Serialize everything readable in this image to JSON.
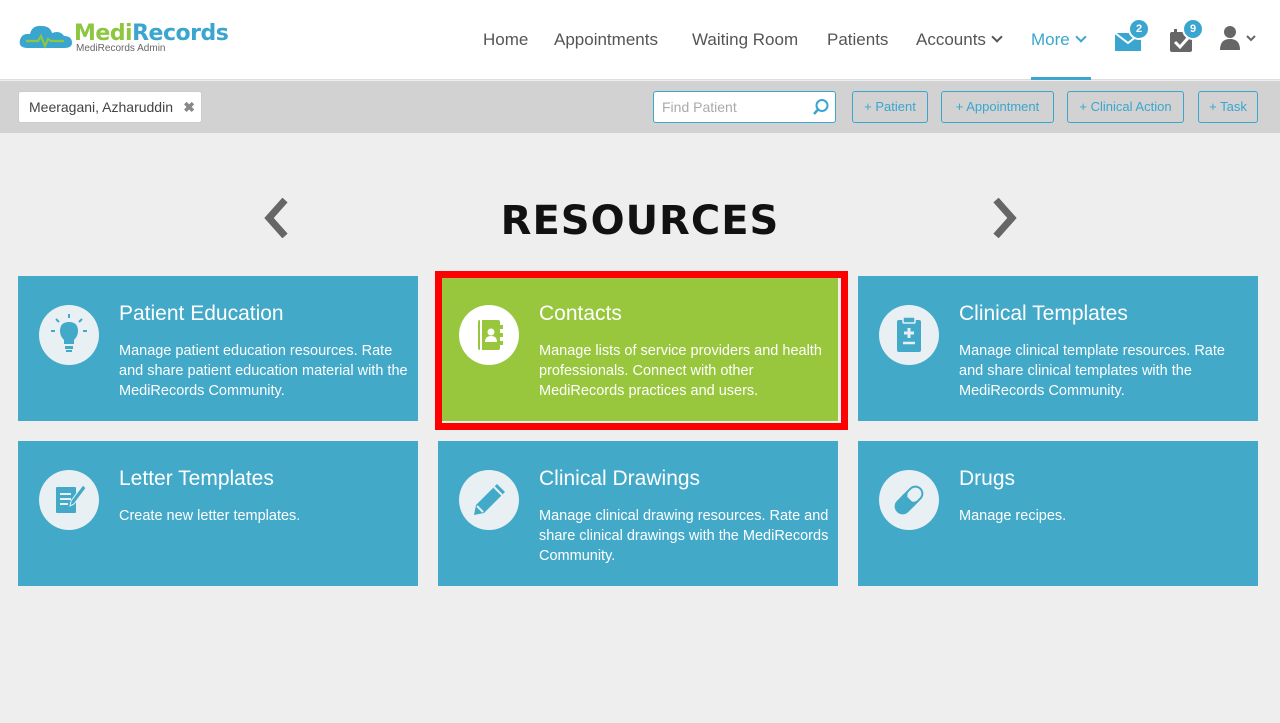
{
  "app": {
    "name_part1": "Medi",
    "name_part2": "Records",
    "subtitle": "MediRecords Admin"
  },
  "nav": {
    "home": "Home",
    "appointments": "Appointments",
    "waiting_room": "Waiting Room",
    "patients": "Patients",
    "accounts": "Accounts",
    "more": "More",
    "messages_count": "2",
    "tasks_count": "9"
  },
  "toolbar": {
    "patient_chip": "Meeragani, Azharuddin",
    "chip_close": "✖",
    "find_placeholder": "Find Patient",
    "add_patient": "+ Patient",
    "add_appointment": "+ Appointment",
    "add_clinical_action": "+ Clinical Action",
    "add_task": "+ Task"
  },
  "page": {
    "title": "RESOURCES"
  },
  "cards": [
    {
      "title": "Patient Education",
      "desc": "Manage patient education resources. Rate and share patient education material with the MediRecords Community.",
      "icon": "lightbulb-icon"
    },
    {
      "title": "Contacts",
      "desc": "Manage lists of service providers and health professionals. Connect with other MediRecords practices and users.",
      "icon": "contact-book-icon",
      "highlighted": true
    },
    {
      "title": "Clinical Templates",
      "desc": "Manage clinical template resources. Rate and share clinical templates with the MediRecords Community.",
      "icon": "clipboard-icon"
    },
    {
      "title": "Letter Templates",
      "desc": "Create new letter templates.",
      "icon": "letter-edit-icon"
    },
    {
      "title": "Clinical Drawings",
      "desc": "Manage clinical drawing resources. Rate and share clinical drawings with the MediRecords Community.",
      "icon": "pencil-icon"
    },
    {
      "title": "Drugs",
      "desc": "Manage recipes.",
      "icon": "pill-icon"
    }
  ],
  "colors": {
    "brand_blue": "#3aa6cf",
    "brand_green": "#8dc63f",
    "card_blue": "#42a9c9",
    "card_green": "#98c73e",
    "highlight_red": "#ff0000"
  }
}
